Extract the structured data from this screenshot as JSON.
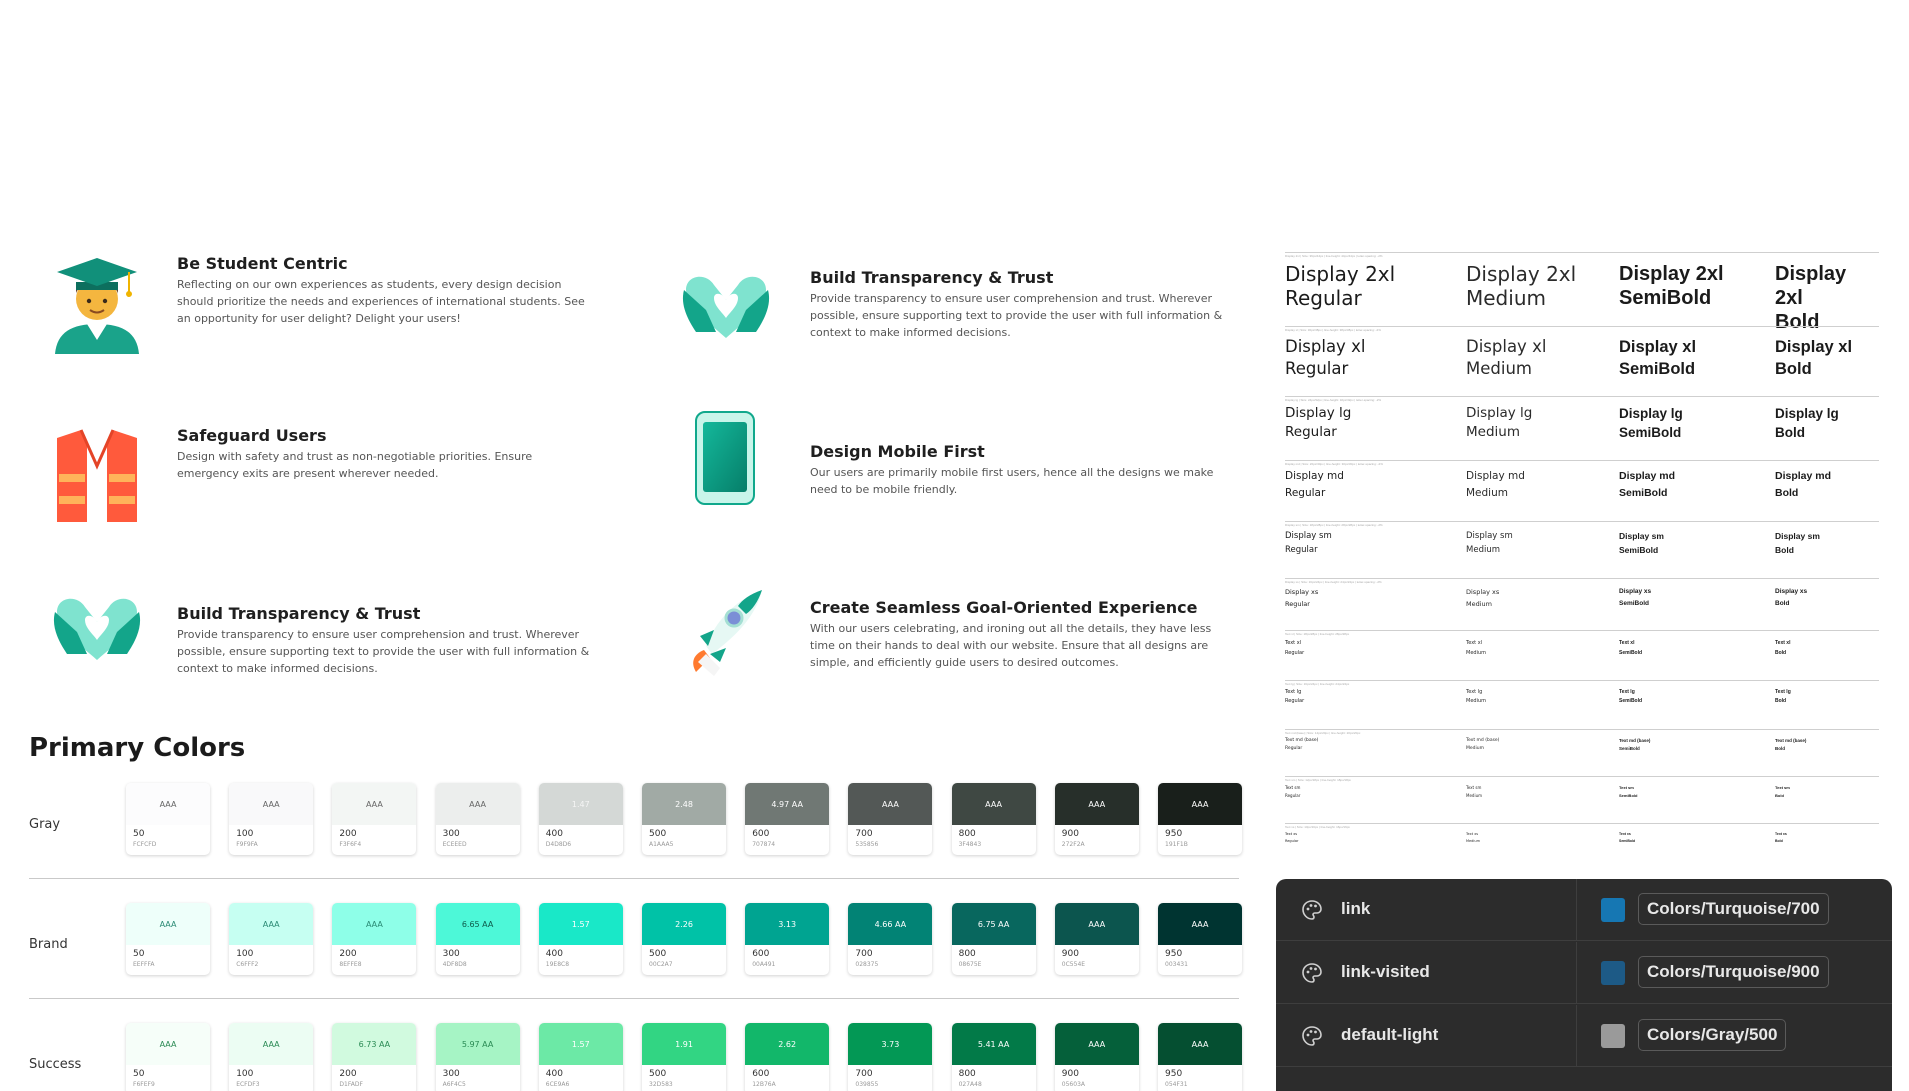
{
  "principles": [
    {
      "title": "Be Student Centric",
      "body": "Reflecting on our own experiences as students, every design decision should prioritize the needs and experiences of international students. See an opportunity for user delight? Delight your users!",
      "icon": "graduate-student-icon"
    },
    {
      "title": "Build Transparency & Trust",
      "body": "Provide transparency to ensure user comprehension and trust. Wherever possible, ensure supporting text to provide the user with full information & context to make informed decisions.",
      "icon": "heart-hands-icon"
    },
    {
      "title": "Safeguard Users",
      "body": "Design with safety and trust as non-negotiable priorities. Ensure emergency exits are present wherever needed.",
      "icon": "safety-vest-icon"
    },
    {
      "title": "Design Mobile First",
      "body": "Our users are primarily mobile first users, hence all the designs we make need to be mobile friendly.",
      "icon": "mobile-phone-icon"
    },
    {
      "title": "Build Transparency & Trust",
      "body": "Provide transparency to ensure user comprehension and trust. Wherever possible, ensure supporting text to provide the user with full information & context to make informed decisions.",
      "icon": "heart-hands-icon"
    },
    {
      "title": "Create Seamless Goal-Oriented Experience",
      "body": "With our users celebrating, and ironing out all the details, they have less time on their hands to deal with our website. Ensure that all designs are simple, and efficiently guide users to desired outcomes.",
      "icon": "rocket-icon"
    }
  ],
  "primary_colors": {
    "title": "Primary Colors",
    "rows": [
      {
        "name": "Gray",
        "swatches": [
          {
            "step": "50",
            "hex": "FCFCFD",
            "color": "#FCFCFD",
            "label": "AAA",
            "label_color": "#666"
          },
          {
            "step": "100",
            "hex": "F9F9FA",
            "color": "#F9F9FA",
            "label": "AAA",
            "label_color": "#666"
          },
          {
            "step": "200",
            "hex": "F3F6F4",
            "color": "#F3F6F4",
            "label": "AAA",
            "label_color": "#666"
          },
          {
            "step": "300",
            "hex": "ECEEED",
            "color": "#ECEEED",
            "label": "AAA",
            "label_color": "#666"
          },
          {
            "step": "400",
            "hex": "D4D8D6",
            "color": "#D4D8D6",
            "label": "1.47",
            "label_color": "#f5f5f5"
          },
          {
            "step": "500",
            "hex": "A1AAA5",
            "color": "#A1AAA5",
            "label": "2.48",
            "label_color": "#ffffff"
          },
          {
            "step": "600",
            "hex": "707874",
            "color": "#707874",
            "label": "4.97 AA",
            "label_color": "#ffffff"
          },
          {
            "step": "700",
            "hex": "535856",
            "color": "#535856",
            "label": "AAA",
            "label_color": "#ffffff"
          },
          {
            "step": "800",
            "hex": "3F4843",
            "color": "#3F4843",
            "label": "AAA",
            "label_color": "#ffffff"
          },
          {
            "step": "900",
            "hex": "272F2A",
            "color": "#272F2A",
            "label": "AAA",
            "label_color": "#ffffff"
          },
          {
            "step": "950",
            "hex": "191F1B",
            "color": "#191F1B",
            "label": "AAA",
            "label_color": "#ffffff"
          }
        ]
      },
      {
        "name": "Brand",
        "swatches": [
          {
            "step": "50",
            "hex": "EEFFFA",
            "color": "#EEFFFA",
            "label": "AAA",
            "label_color": "#2a8a74"
          },
          {
            "step": "100",
            "hex": "C6FFF2",
            "color": "#C6FFF2",
            "label": "AAA",
            "label_color": "#2a8a74"
          },
          {
            "step": "200",
            "hex": "8EFFE8",
            "color": "#8EFFE8",
            "label": "AAA",
            "label_color": "#2a8a74"
          },
          {
            "step": "300",
            "hex": "4DF8D8",
            "color": "#4DF8D8",
            "label": "6.65 AA",
            "label_color": "#0e5a4a"
          },
          {
            "step": "400",
            "hex": "19E8C8",
            "color": "#19E8C8",
            "label": "1.57",
            "label_color": "#ffffff"
          },
          {
            "step": "500",
            "hex": "00C2A7",
            "color": "#00C2A7",
            "label": "2.26",
            "label_color": "#ffffff"
          },
          {
            "step": "600",
            "hex": "00A491",
            "color": "#00A491",
            "label": "3.13",
            "label_color": "#ffffff"
          },
          {
            "step": "700",
            "hex": "028375",
            "color": "#028375",
            "label": "4.66 AA",
            "label_color": "#ffffff"
          },
          {
            "step": "800",
            "hex": "08675E",
            "color": "#08675E",
            "label": "6.75 AA",
            "label_color": "#ffffff"
          },
          {
            "step": "900",
            "hex": "0C554E",
            "color": "#0C554E",
            "label": "AAA",
            "label_color": "#ffffff"
          },
          {
            "step": "950",
            "hex": "003431",
            "color": "#003431",
            "label": "AAA",
            "label_color": "#ffffff"
          }
        ]
      },
      {
        "name": "Success",
        "swatches": [
          {
            "step": "50",
            "hex": "F6FEF9",
            "color": "#F6FEF9",
            "label": "AAA",
            "label_color": "#2a8a54"
          },
          {
            "step": "100",
            "hex": "ECFDF3",
            "color": "#ECFDF3",
            "label": "AAA",
            "label_color": "#2a8a54"
          },
          {
            "step": "200",
            "hex": "D1FADF",
            "color": "#D1FADF",
            "label": "6.73 AA",
            "label_color": "#2a8a54"
          },
          {
            "step": "300",
            "hex": "A6F4C5",
            "color": "#A6F4C5",
            "label": "5.97 AA",
            "label_color": "#2a8a54"
          },
          {
            "step": "400",
            "hex": "6CE9A6",
            "color": "#6CE9A6",
            "label": "1.57",
            "label_color": "#ffffff"
          },
          {
            "step": "500",
            "hex": "32D583",
            "color": "#32D583",
            "label": "1.91",
            "label_color": "#ffffff"
          },
          {
            "step": "600",
            "hex": "12B76A",
            "color": "#12B76A",
            "label": "2.62",
            "label_color": "#ffffff"
          },
          {
            "step": "700",
            "hex": "039855",
            "color": "#039855",
            "label": "3.73",
            "label_color": "#ffffff"
          },
          {
            "step": "800",
            "hex": "027A48",
            "color": "#027A48",
            "label": "5.41 AA",
            "label_color": "#ffffff"
          },
          {
            "step": "900",
            "hex": "05603A",
            "color": "#05603A",
            "label": "AAA",
            "label_color": "#ffffff"
          },
          {
            "step": "950",
            "hex": "054F31",
            "color": "#054F31",
            "label": "AAA",
            "label_color": "#ffffff"
          }
        ]
      }
    ]
  },
  "typography": {
    "weights": [
      "Regular",
      "Medium",
      "SemiBold",
      "Bold"
    ],
    "rows": [
      {
        "name": "Display 2xl",
        "meta": "Display 2xl | Size: 36px/44px | line-height: 44px/44px | letter-spacing: -2%"
      },
      {
        "name": "Display xl",
        "meta": "Display xl | Size: 30px/38px | line-height: 38px/38px | letter-spacing: -2%"
      },
      {
        "name": "Display lg",
        "meta": "Display lg | Size: 24px/32px | line-height: 32px/32px | letter-spacing: -2%"
      },
      {
        "name": "Display md",
        "meta": "Display md | Size: 20px/30px | line-height: 30px/30px | letter-spacing: -2%"
      },
      {
        "name": "Display sm",
        "meta": "Display sm | Size: 18px/28px | line-height: 28px/28px | letter-spacing: -2%"
      },
      {
        "name": "Display xs",
        "meta": "Display xs | Size: 16px/24px | line-height: 24px/24px | letter-spacing: -2%"
      },
      {
        "name": "Text xl",
        "meta": "Text xl | Size: 18px/28px | line-height: 28px/28px"
      },
      {
        "name": "Text lg",
        "meta": "Text lg | Size: 16px/24px | line-height: 24px/24px"
      },
      {
        "name": "Text md (base)",
        "meta": "Text md (base) | Size: 14px/20px | line-height: 20px/20px"
      },
      {
        "name": "Text sm",
        "meta": "Text sm | Size: 12px/18px | line-height: 18px/18px"
      },
      {
        "name": "Text xs",
        "meta": "Text xs | Size: 10px/16px | line-height: 16px/16px"
      }
    ]
  },
  "tokens": [
    {
      "name": "link",
      "value": "Colors/Turquoise/700",
      "color": "#1677b3"
    },
    {
      "name": "link-visited",
      "value": "Colors/Turquoise/900",
      "color": "#1d5a86"
    },
    {
      "name": "default-light",
      "value": "Colors/Gray/500",
      "color": "#9a9a9a"
    }
  ]
}
